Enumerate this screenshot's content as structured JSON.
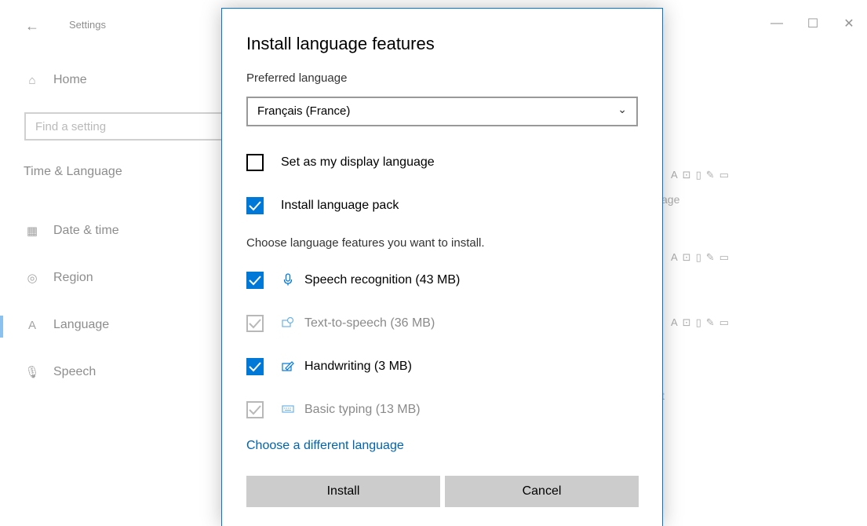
{
  "window": {
    "title": "Settings",
    "back_glyph": "←",
    "controls": {
      "minimize": "—",
      "maximize": "☐",
      "close": "✕"
    }
  },
  "sidebar": {
    "home": "Home",
    "search_placeholder": "Find a setting",
    "section": "Time & Language",
    "items": [
      {
        "label": "Date & time",
        "icon": "calendar-clock-icon"
      },
      {
        "label": "Region",
        "icon": "globe-icon"
      },
      {
        "label": "Language",
        "icon": "language-icon"
      },
      {
        "label": "Speech",
        "icon": "microphone-icon"
      }
    ]
  },
  "background_fragments": {
    "fragment_1": "age",
    "fragment_2": "t"
  },
  "dialog": {
    "title": "Install language features",
    "preferred_label": "Preferred language",
    "selected_language": "Français (France)",
    "options": [
      {
        "label": "Set as my display language",
        "checked": false
      },
      {
        "label": "Install language pack",
        "checked": true
      }
    ],
    "features_hint": "Choose language features you want to install.",
    "features": [
      {
        "label": "Speech recognition (43 MB)",
        "icon": "microphone-icon",
        "checked": true,
        "disabled": false
      },
      {
        "label": "Text-to-speech (36 MB)",
        "icon": "text-to-speech-icon",
        "checked": true,
        "disabled": true
      },
      {
        "label": "Handwriting (3 MB)",
        "icon": "handwriting-icon",
        "checked": true,
        "disabled": false
      },
      {
        "label": "Basic typing (13 MB)",
        "icon": "keyboard-icon",
        "checked": true,
        "disabled": true
      }
    ],
    "link": "Choose a different language",
    "install_label": "Install",
    "cancel_label": "Cancel"
  },
  "colors": {
    "accent": "#0078d7",
    "button_bg": "#cccccc",
    "link": "#0063b1"
  }
}
